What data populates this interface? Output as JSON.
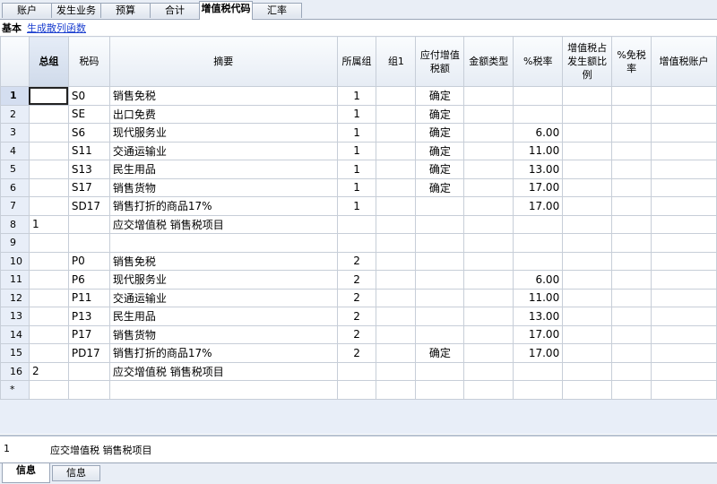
{
  "tabs": [
    "账户",
    "发生业务",
    "预算",
    "合计",
    "增值税代码",
    "汇率"
  ],
  "active_tab": "增值税代码",
  "view": {
    "label": "基本",
    "link": "生成散列函数"
  },
  "columns": [
    "",
    "总组",
    "税码",
    "摘要",
    "所属组",
    "组1",
    "应付增值税额",
    "金额类型",
    "%税率",
    "增值税占发生额比例",
    "%免税率",
    "增值税账户"
  ],
  "rows": [
    {
      "n": "1",
      "g": "",
      "code": "S0",
      "desc": "销售免税",
      "grp": "1",
      "g1": "",
      "due": "确定",
      "amt": "",
      "rate": "",
      "ratio": "",
      "exempt": "",
      "acct": ""
    },
    {
      "n": "2",
      "g": "",
      "code": "SE",
      "desc": "出口免费",
      "grp": "1",
      "g1": "",
      "due": "确定",
      "amt": "",
      "rate": "",
      "ratio": "",
      "exempt": "",
      "acct": ""
    },
    {
      "n": "3",
      "g": "",
      "code": "S6",
      "desc": "现代服务业",
      "grp": "1",
      "g1": "",
      "due": "确定",
      "amt": "",
      "rate": "6.00",
      "ratio": "",
      "exempt": "",
      "acct": ""
    },
    {
      "n": "4",
      "g": "",
      "code": "S11",
      "desc": "交通运输业",
      "grp": "1",
      "g1": "",
      "due": "确定",
      "amt": "",
      "rate": "11.00",
      "ratio": "",
      "exempt": "",
      "acct": ""
    },
    {
      "n": "5",
      "g": "",
      "code": "S13",
      "desc": "民生用品",
      "grp": "1",
      "g1": "",
      "due": "确定",
      "amt": "",
      "rate": "13.00",
      "ratio": "",
      "exempt": "",
      "acct": ""
    },
    {
      "n": "6",
      "g": "",
      "code": "S17",
      "desc": "销售货物",
      "grp": "1",
      "g1": "",
      "due": "确定",
      "amt": "",
      "rate": "17.00",
      "ratio": "",
      "exempt": "",
      "acct": ""
    },
    {
      "n": "7",
      "g": "",
      "code": "SD17",
      "desc": "销售打折的商品17%",
      "grp": "1",
      "g1": "",
      "due": "",
      "amt": "",
      "rate": "17.00",
      "ratio": "",
      "exempt": "",
      "acct": ""
    },
    {
      "n": "8",
      "g": "1",
      "code": "",
      "desc": "应交增值税 销售税项目",
      "grp": "",
      "g1": "",
      "due": "",
      "amt": "",
      "rate": "",
      "ratio": "",
      "exempt": "",
      "acct": ""
    },
    {
      "n": "9",
      "g": "",
      "code": "",
      "desc": "",
      "grp": "",
      "g1": "",
      "due": "",
      "amt": "",
      "rate": "",
      "ratio": "",
      "exempt": "",
      "acct": ""
    },
    {
      "n": "10",
      "g": "",
      "code": "P0",
      "desc": "销售免税",
      "grp": "2",
      "g1": "",
      "due": "",
      "amt": "",
      "rate": "",
      "ratio": "",
      "exempt": "",
      "acct": ""
    },
    {
      "n": "11",
      "g": "",
      "code": "P6",
      "desc": "现代服务业",
      "grp": "2",
      "g1": "",
      "due": "",
      "amt": "",
      "rate": "6.00",
      "ratio": "",
      "exempt": "",
      "acct": ""
    },
    {
      "n": "12",
      "g": "",
      "code": "P11",
      "desc": "交通运输业",
      "grp": "2",
      "g1": "",
      "due": "",
      "amt": "",
      "rate": "11.00",
      "ratio": "",
      "exempt": "",
      "acct": ""
    },
    {
      "n": "13",
      "g": "",
      "code": "P13",
      "desc": "民生用品",
      "grp": "2",
      "g1": "",
      "due": "",
      "amt": "",
      "rate": "13.00",
      "ratio": "",
      "exempt": "",
      "acct": ""
    },
    {
      "n": "14",
      "g": "",
      "code": "P17",
      "desc": "销售货物",
      "grp": "2",
      "g1": "",
      "due": "",
      "amt": "",
      "rate": "17.00",
      "ratio": "",
      "exempt": "",
      "acct": ""
    },
    {
      "n": "15",
      "g": "",
      "code": "PD17",
      "desc": "销售打折的商品17%",
      "grp": "2",
      "g1": "",
      "due": "确定",
      "amt": "",
      "rate": "17.00",
      "ratio": "",
      "exempt": "",
      "acct": ""
    },
    {
      "n": "16",
      "g": "2",
      "code": "",
      "desc": "应交增值税 销售税项目",
      "grp": "",
      "g1": "",
      "due": "",
      "amt": "",
      "rate": "",
      "ratio": "",
      "exempt": "",
      "acct": ""
    },
    {
      "n": "*",
      "g": "",
      "code": "",
      "desc": "",
      "grp": "",
      "g1": "",
      "due": "",
      "amt": "",
      "rate": "",
      "ratio": "",
      "exempt": "",
      "acct": ""
    }
  ],
  "status": {
    "row": "1",
    "text": "应交增值税 销售税项目"
  },
  "bottom_tabs": [
    "信息",
    "信息"
  ]
}
